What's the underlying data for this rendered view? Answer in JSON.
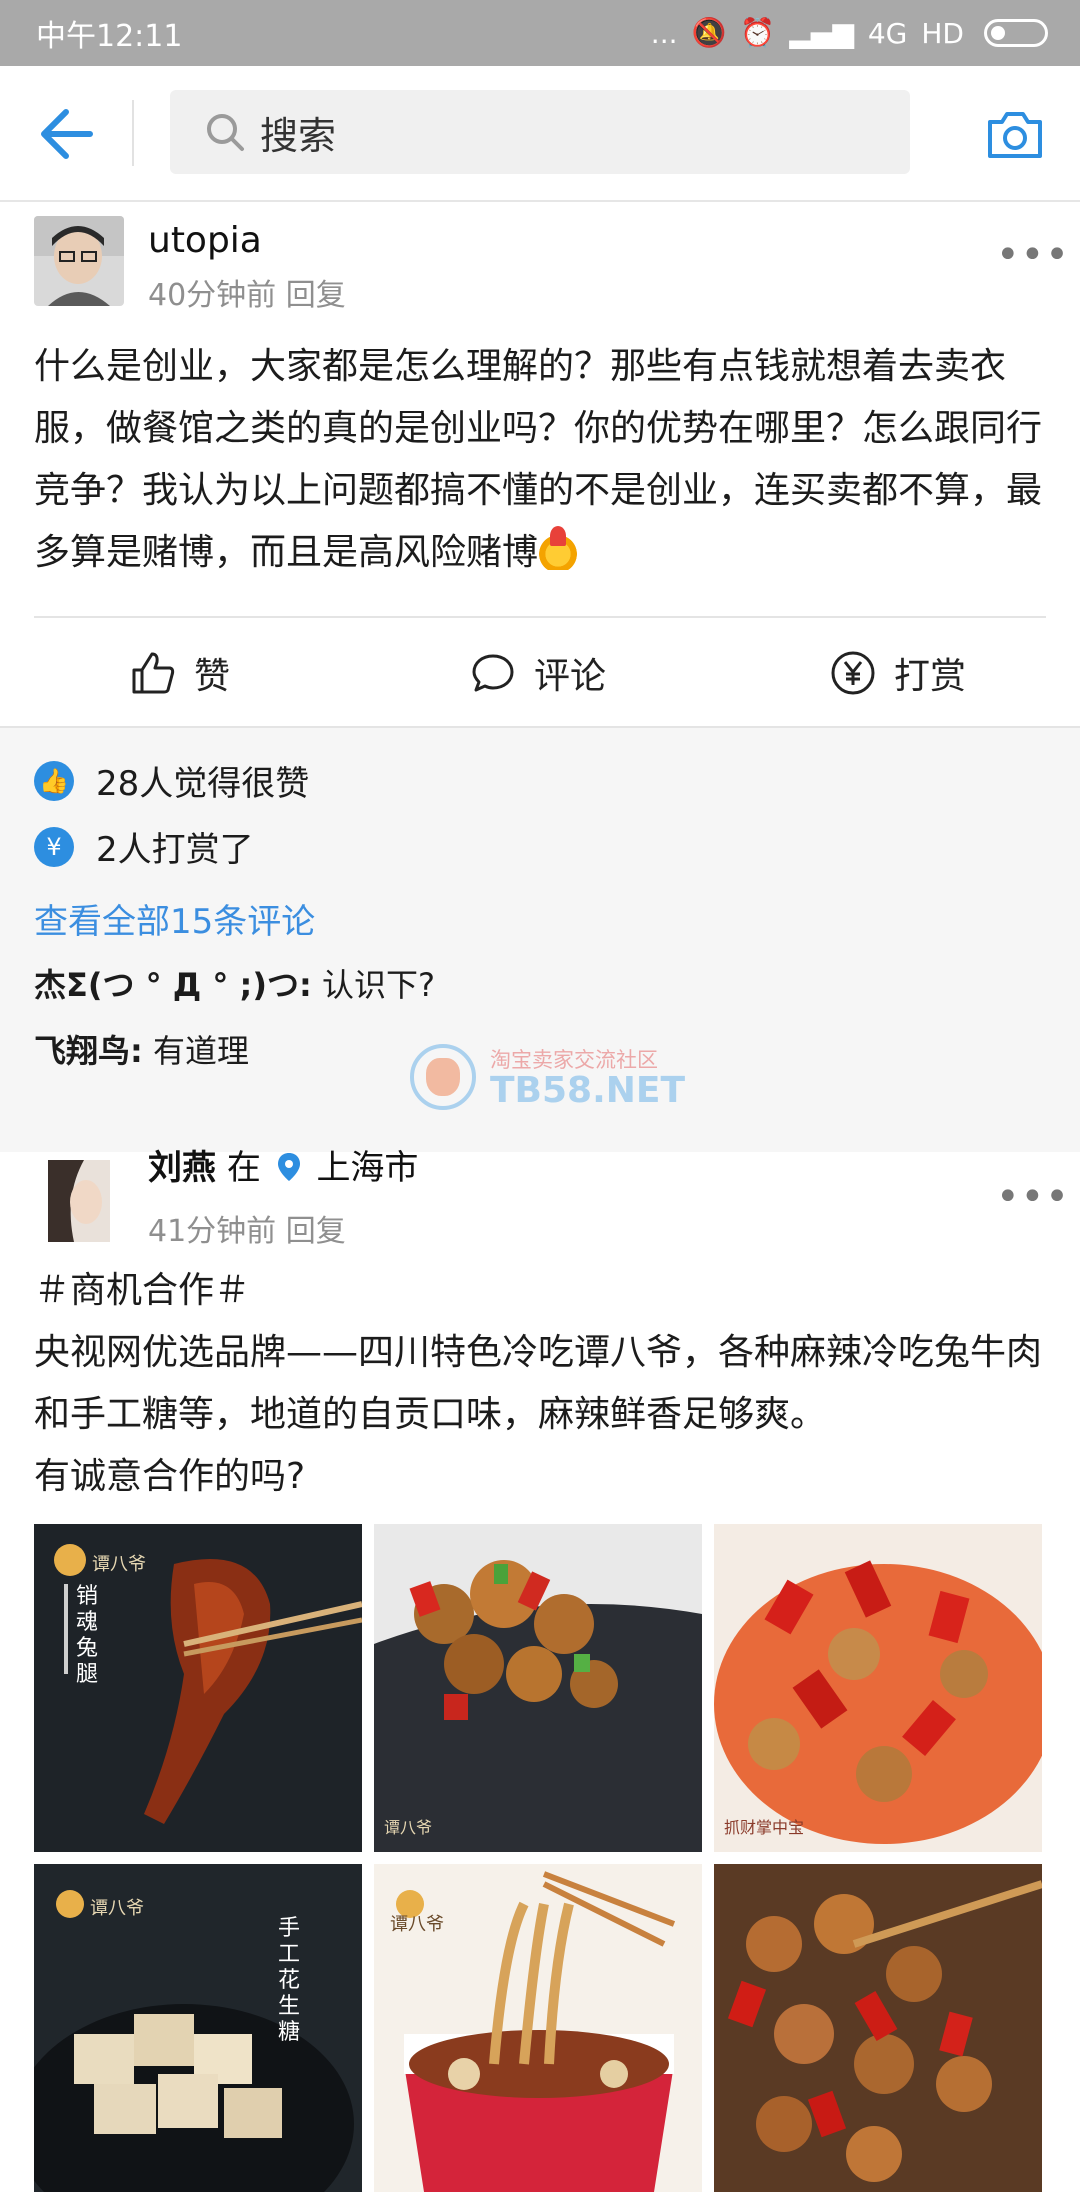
{
  "status_bar": {
    "time": "中午12:11",
    "dots": "...",
    "network": "4G",
    "hd": "HD"
  },
  "header": {
    "search_placeholder": "搜索"
  },
  "post1": {
    "username": "utopia",
    "time": "40分钟前",
    "reply": "回复",
    "more": "•••",
    "body": "什么是创业，大家都是怎么理解的？那些有点钱就想着去卖衣服，做餐馆之类的真的是创业吗？你的优势在哪里？怎么跟同行竞争？我认为以上问题都搞不懂的不是创业，连买卖都不算，最多算是赌博，而且是高风险赌博",
    "actions": {
      "like": "赞",
      "comment": "评论",
      "tip": "打赏"
    },
    "likes_text": "28人觉得很赞",
    "tips_text": "2人打赏了",
    "view_all": "查看全部15条评论",
    "comments": [
      {
        "author": "杰Σ(つ ° Д ° ;)つ:",
        "text": " 认识下?"
      },
      {
        "author": "飞翔鸟:",
        "text": " 有道理"
      }
    ]
  },
  "watermark": {
    "cn": "淘宝卖家交流社区",
    "en": "TB58.NET"
  },
  "post2": {
    "username": "刘燕",
    "at": "在",
    "location": "上海市",
    "time": "41分钟前",
    "reply": "回复",
    "more": "•••",
    "topic": "＃商机合作＃",
    "body": "央视网优选品牌——四川特色冷吃谭八爷，各种麻辣冷吃兔牛肉和手工糖等，地道的自贡口味，麻辣鲜香足够爽。",
    "question": "有诚意合作的吗?",
    "images": [
      {
        "brand": "谭八爷",
        "caption": "销魂兔腿"
      },
      {
        "brand": "谭八爷",
        "caption": ""
      },
      {
        "brand": "",
        "caption": "抓财掌中宝"
      },
      {
        "brand": "谭八爷",
        "caption": "手工花生糖"
      },
      {
        "brand": "谭八爷",
        "caption": ""
      },
      {
        "brand": "",
        "caption": ""
      }
    ]
  },
  "colors": {
    "accent": "#2d8ee0",
    "link": "#3b8ee0",
    "status_bar": "#a9a9a9"
  }
}
